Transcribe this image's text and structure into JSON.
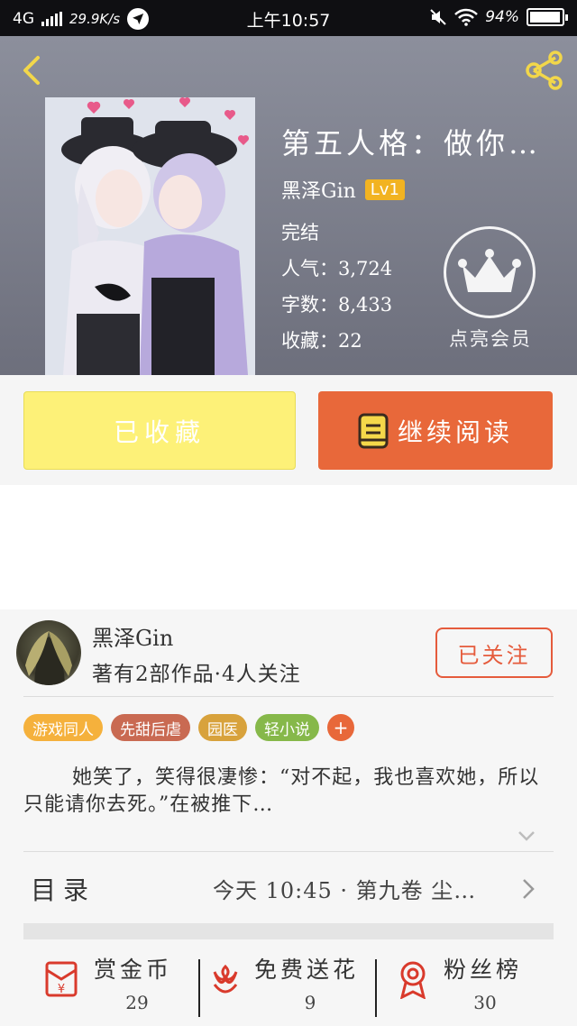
{
  "status_bar": {
    "network": "4G",
    "speed": "29.9K/s",
    "time": "上午10:57",
    "battery": "94%"
  },
  "book": {
    "title": "第五人格：做你…",
    "author": "黑泽Gin",
    "level": "Lv1",
    "status": "完结",
    "popularity_label": "人气：",
    "popularity": "3,724",
    "words_label": "字数：",
    "words": "8,433",
    "favorites_label": "收藏：",
    "favorites": "22",
    "vip_label": "点亮会员"
  },
  "actions": {
    "favorited_label": "已收藏",
    "continue_label": "继续阅读"
  },
  "author_card": {
    "name": "黑泽Gin",
    "stats": "著有2部作品·4人关注",
    "follow_label": "已关注"
  },
  "tags": [
    {
      "label": "游戏同人",
      "color": "#f5b13c"
    },
    {
      "label": "先甜后虐",
      "color": "#c96a52"
    },
    {
      "label": "园医",
      "color": "#d8a23c"
    },
    {
      "label": "轻小说",
      "color": "#86b84a"
    }
  ],
  "tag_add": "+",
  "description": "她笑了，笑得很凄惨：“对不起，我也喜欢她，所以只能请你去死。”在被推下…",
  "toc": {
    "label": "目录",
    "latest": "今天 10:45 · 第九卷 尘…"
  },
  "bottom_bar": {
    "reward_label": "赏金币",
    "reward_count": "29",
    "flower_label": "免费送花",
    "flower_count": "9",
    "fans_label": "粉丝榜",
    "fans_count": "30"
  },
  "colors": {
    "accent": "#e8683a",
    "fav_button": "#fdf178",
    "level_badge": "#f2b321",
    "header_bg": "#7d808d"
  }
}
